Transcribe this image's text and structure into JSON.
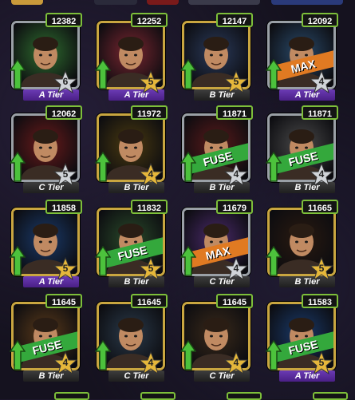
{
  "cards": [
    {
      "score": "12382",
      "tier": "A Tier",
      "tierClass": "A",
      "stars": "6",
      "starColor": "#d0d4d8",
      "frame": "silver",
      "bg": "#2f6d2f",
      "banner": ""
    },
    {
      "score": "12252",
      "tier": "A Tier",
      "tierClass": "A",
      "stars": "5",
      "starColor": "#e5b73b",
      "frame": "gold",
      "bg": "#7a2630",
      "banner": ""
    },
    {
      "score": "12147",
      "tier": "B Tier",
      "tierClass": "B",
      "stars": "5",
      "starColor": "#e5b73b",
      "frame": "gold",
      "bg": "#2a3a5a",
      "banner": ""
    },
    {
      "score": "12092",
      "tier": "A Tier",
      "tierClass": "A",
      "stars": "4",
      "starColor": "#d0d4d8",
      "frame": "silver",
      "bg": "#2a4a6a",
      "banner": "MAX"
    },
    {
      "score": "12062",
      "tier": "C Tier",
      "tierClass": "C",
      "stars": "5",
      "starColor": "#d0d4d8",
      "frame": "silver",
      "bg": "#6a1a1a",
      "banner": ""
    },
    {
      "score": "11972",
      "tier": "B Tier",
      "tierClass": "B",
      "stars": "4",
      "starColor": "#e5b73b",
      "frame": "gold",
      "bg": "#4a3a10",
      "banner": ""
    },
    {
      "score": "11871",
      "tier": "B Tier",
      "tierClass": "B",
      "stars": "4",
      "starColor": "#d0d4d8",
      "frame": "silver",
      "bg": "#5a1a1a",
      "banner": "FUSE"
    },
    {
      "score": "11871",
      "tier": "B Tier",
      "tierClass": "B",
      "stars": "4",
      "starColor": "#d0d4d8",
      "frame": "silver",
      "bg": "#4a4a4a",
      "banner": "FUSE"
    },
    {
      "score": "11858",
      "tier": "A Tier",
      "tierClass": "A",
      "stars": "5",
      "starColor": "#e5b73b",
      "frame": "gold",
      "bg": "#1a3a6a",
      "banner": ""
    },
    {
      "score": "11832",
      "tier": "B Tier",
      "tierClass": "B",
      "stars": "5",
      "starColor": "#e5b73b",
      "frame": "gold",
      "bg": "#2a4a2a",
      "banner": "FUSE"
    },
    {
      "score": "11679",
      "tier": "C Tier",
      "tierClass": "C",
      "stars": "4",
      "starColor": "#d0d4d8",
      "frame": "silver",
      "bg": "#4a2a6a",
      "banner": "MAX"
    },
    {
      "score": "11665",
      "tier": "B Tier",
      "tierClass": "B",
      "stars": "5",
      "starColor": "#e5b73b",
      "frame": "gold",
      "bg": "#2a1a10",
      "banner": ""
    },
    {
      "score": "11645",
      "tier": "B Tier",
      "tierClass": "B",
      "stars": "4",
      "starColor": "#e5b73b",
      "frame": "gold",
      "bg": "#5a3a1a",
      "banner": "FUSE"
    },
    {
      "score": "11645",
      "tier": "C Tier",
      "tierClass": "C",
      "stars": "4",
      "starColor": "#e5b73b",
      "frame": "gold",
      "bg": "#2a3a4a",
      "banner": ""
    },
    {
      "score": "11645",
      "tier": "C Tier",
      "tierClass": "C",
      "stars": "4",
      "starColor": "#e5b73b",
      "frame": "gold",
      "bg": "#3a2a1a",
      "banner": ""
    },
    {
      "score": "11583",
      "tier": "A Tier",
      "tierClass": "A",
      "stars": "5",
      "starColor": "#e5b73b",
      "frame": "gold",
      "bg": "#1a3a6a",
      "banner": "FUSE"
    }
  ]
}
